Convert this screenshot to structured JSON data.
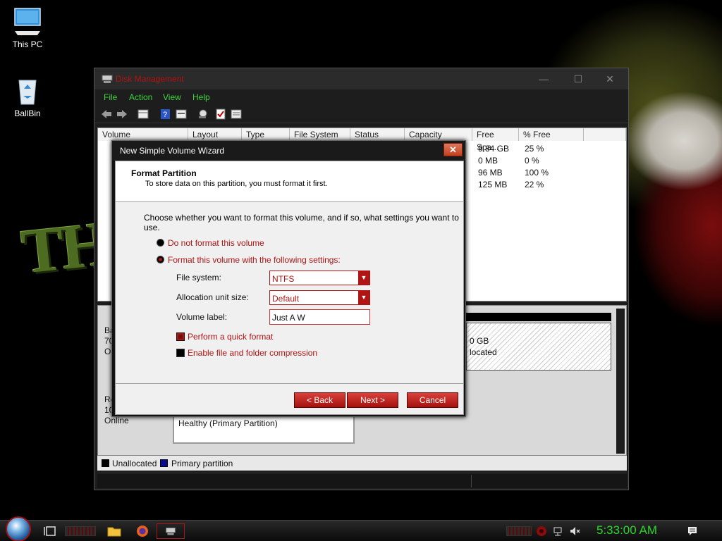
{
  "desktop": {
    "icons": [
      {
        "label": "This PC",
        "icon": "computer-icon"
      },
      {
        "label": "BallBin",
        "icon": "recycle-bin-icon"
      }
    ],
    "wallpaper_text": "THE GR"
  },
  "disk_management": {
    "title": "Disk Management",
    "menu": [
      "File",
      "Action",
      "View",
      "Help"
    ],
    "toolbar_icons": [
      "back-icon",
      "forward-icon",
      "grid-icon",
      "help-icon",
      "properties-icon",
      "search-disk-icon",
      "check-icon",
      "list-icon"
    ],
    "columns": [
      "Volume",
      "Layout",
      "Type",
      "File System",
      "Status",
      "Capacity",
      "Free Spa...",
      "% Free"
    ],
    "rows": [
      {
        "free": "9.84 GB",
        "pct": "25 %"
      },
      {
        "free": "0 MB",
        "pct": "0 %"
      },
      {
        "free": "96 MB",
        "pct": "100 %"
      },
      {
        "free": "125 MB",
        "pct": "22 %"
      }
    ],
    "graph": {
      "disk0_partial": [
        "Ba",
        "70",
        "Or"
      ],
      "disk1_partial": [
        "Re",
        "10",
        "Online"
      ],
      "unalloc_size": "0 GB",
      "unalloc_label": "located",
      "partition_status": "Healthy (Primary Partition)"
    },
    "legend": [
      {
        "label": "Unallocated",
        "color": "#000000"
      },
      {
        "label": "Primary partition",
        "color": "#0a0a8c"
      }
    ]
  },
  "wizard": {
    "title": "New Simple Volume Wizard",
    "close_glyph": "✕",
    "heading": "Format Partition",
    "subheading": "To store data on this partition, you must format it first.",
    "instruction": "Choose whether you want to format this volume, and if so, what settings you want to use.",
    "option_no_format": "Do not format this volume",
    "option_format": "Format this volume with the following settings:",
    "selected_option": "format",
    "file_system_label": "File system:",
    "file_system_value": "NTFS",
    "alloc_label": "Allocation unit size:",
    "alloc_value": "Default",
    "volume_label_label": "Volume label:",
    "volume_label_value": "Just A W",
    "quick_format_label": "Perform a quick format",
    "quick_format_checked": true,
    "compression_label": "Enable file and folder compression",
    "compression_checked": false,
    "back_label": "< Back",
    "next_label": "Next >",
    "cancel_label": "Cancel"
  },
  "taskbar": {
    "clock": "5:33:00 AM",
    "pinned": [
      "task-view-icon",
      "file-explorer-icon",
      "firefox-icon",
      "disk-management-icon"
    ],
    "tray": [
      "tray-app-icon",
      "network-icon",
      "mute-icon",
      "notification-icon"
    ]
  }
}
